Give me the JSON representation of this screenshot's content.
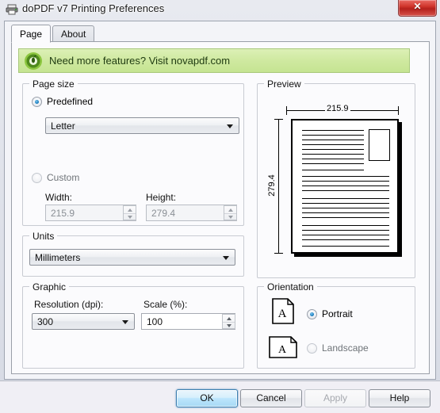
{
  "window": {
    "title": "doPDF v7 Printing Preferences",
    "icon": "printer-icon",
    "close_label": "✕"
  },
  "tabs": [
    {
      "label": "Page",
      "active": true
    },
    {
      "label": "About",
      "active": false
    }
  ],
  "banner": {
    "text": "Need more features? Visit novapdf.com",
    "icon": "novapdf-logo-icon",
    "bg_color": "#cfe9a0"
  },
  "page_size": {
    "group_title": "Page size",
    "predefined": {
      "label": "Predefined",
      "selected": true
    },
    "predefined_value": "Letter",
    "custom": {
      "label": "Custom",
      "selected": false
    },
    "width_label": "Width:",
    "width_value": "215.9",
    "height_label": "Height:",
    "height_value": "279.4"
  },
  "units": {
    "group_title": "Units",
    "value": "Millimeters"
  },
  "graphic": {
    "group_title": "Graphic",
    "resolution_label": "Resolution (dpi):",
    "resolution_value": "300",
    "scale_label": "Scale (%):",
    "scale_value": "100"
  },
  "preview": {
    "group_title": "Preview",
    "width_dim": "215.9",
    "height_dim": "279.4"
  },
  "orientation": {
    "group_title": "Orientation",
    "portrait": {
      "label": "Portrait",
      "selected": true
    },
    "landscape": {
      "label": "Landscape",
      "selected": false
    },
    "icon_letter": "A"
  },
  "buttons": {
    "ok": "OK",
    "cancel": "Cancel",
    "apply": "Apply",
    "help": "Help"
  }
}
